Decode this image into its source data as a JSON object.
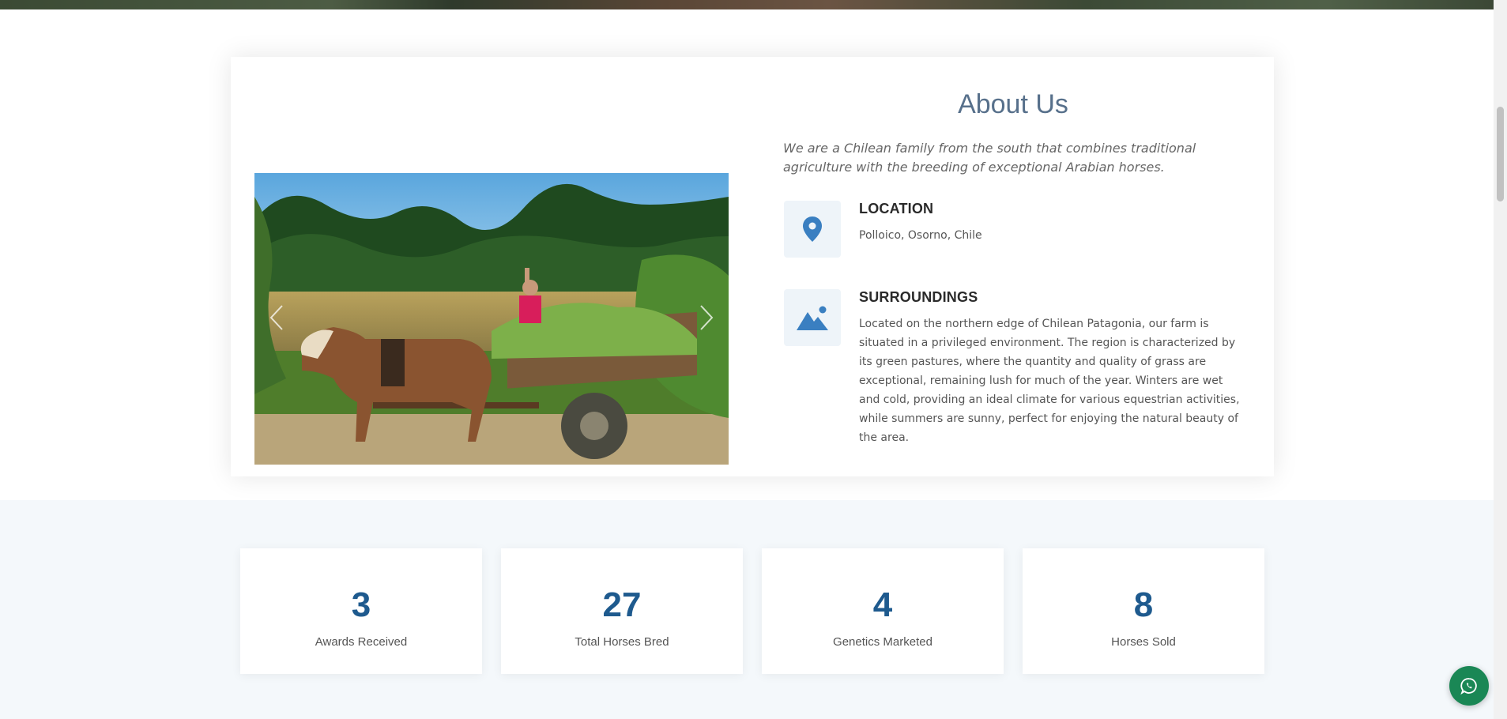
{
  "about": {
    "title": "About Us",
    "intro": "We are a Chilean family from the south that combines traditional agriculture with the breeding of exceptional Arabian horses.",
    "location": {
      "icon": "map-pin-icon",
      "heading": "LOCATION",
      "text": "Polloico, Osorno, Chile"
    },
    "surroundings": {
      "icon": "landscape-icon",
      "heading": "SURROUNDINGS",
      "text": "Located on the northern edge of Chilean Patagonia, our farm is situated in a privileged environment. The region is characterized by its green pastures, where the quantity and quality of grass are exceptional, remaining lush for much of the year. Winters are wet and cold, providing an ideal climate for various equestrian activities, while summers are sunny, perfect for enjoying the natural beauty of the area."
    }
  },
  "carousel": {
    "prev_icon": "chevron-left-icon",
    "next_icon": "chevron-right-icon"
  },
  "stats": [
    {
      "value": "3",
      "label": "Awards Received"
    },
    {
      "value": "27",
      "label": "Total Horses Bred"
    },
    {
      "value": "4",
      "label": "Genetics Marketed"
    },
    {
      "value": "8",
      "label": "Horses Sold"
    }
  ],
  "colors": {
    "accent": "#1e5a8e",
    "title": "#57708b",
    "icon": "#3a7fc1",
    "whatsapp": "#1a8755",
    "band": "#f4f8fb"
  },
  "whatsapp": {
    "icon": "whatsapp-icon"
  }
}
